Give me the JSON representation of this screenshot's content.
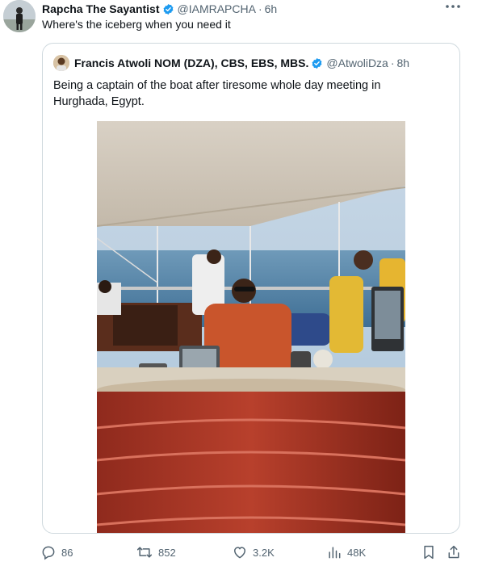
{
  "tweet": {
    "author_name": "Rapcha The Sayantist",
    "author_handle": "@IAMRAPCHA",
    "separator": "·",
    "time": "6h",
    "text": "Where's the iceberg when you need it"
  },
  "quoted": {
    "author_name": "Francis Atwoli NOM (DZA), CBS, EBS, MBS.",
    "author_handle": "@AtwoliDza",
    "separator": "·",
    "time": "8h",
    "text": "Being a captain of the boat after tiresome whole day meeting in Hurghada, Egypt."
  },
  "actions": {
    "replies": "86",
    "reposts": "852",
    "likes": "3.2K",
    "views": "48K"
  },
  "colors": {
    "verified": "#1d9bf0",
    "text_secondary": "#536471",
    "border": "#cfd9de"
  },
  "icons": [
    "verified-badge-icon",
    "more-icon",
    "reply-icon",
    "repost-icon",
    "like-icon",
    "views-icon",
    "bookmark-icon",
    "share-icon"
  ]
}
